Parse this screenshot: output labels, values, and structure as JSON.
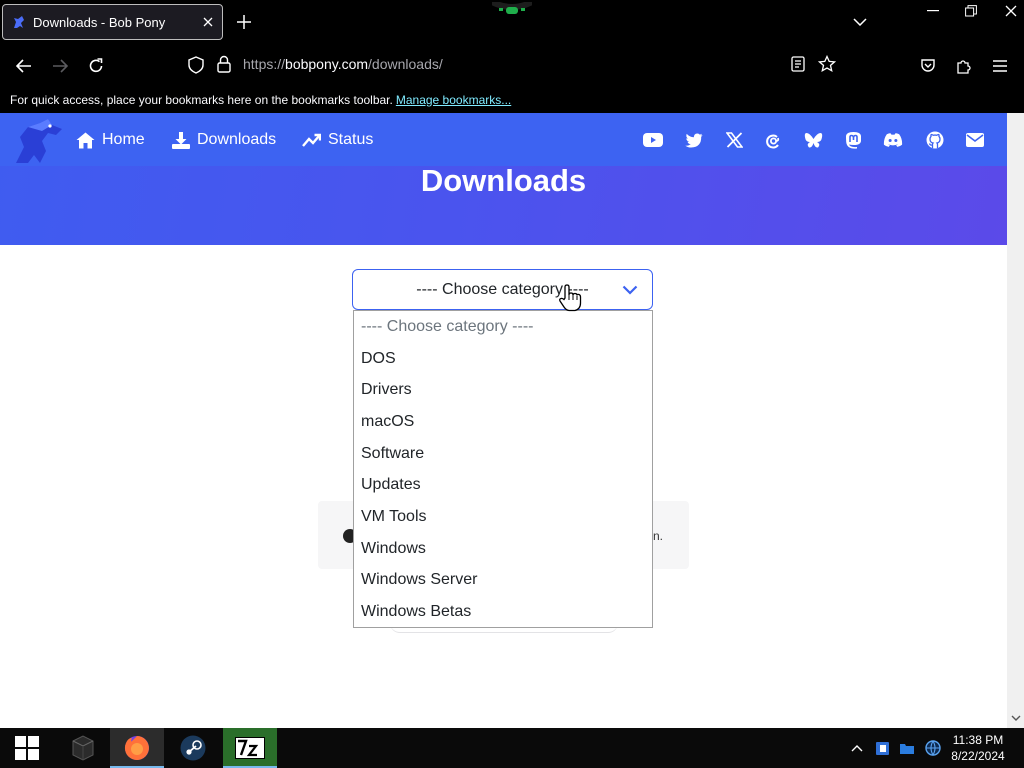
{
  "browser": {
    "tab_title": "Downloads - Bob Pony",
    "url_scheme": "https://",
    "url_host": "bobpony.com",
    "url_path": "/downloads/",
    "bookmarks_hint": "For quick access, place your bookmarks here on the bookmarks toolbar.",
    "bookmarks_link": "Manage bookmarks..."
  },
  "site": {
    "nav": [
      {
        "label": "Home",
        "icon": "home-icon"
      },
      {
        "label": "Downloads",
        "icon": "download-icon"
      },
      {
        "label": "Status",
        "icon": "trend-icon"
      }
    ],
    "social": [
      "youtube-icon",
      "twitter-icon",
      "x-icon",
      "threads-icon",
      "bluesky-icon",
      "mastodon-icon",
      "discord-icon",
      "github-icon",
      "mail-icon"
    ],
    "page_title": "Downloads",
    "select": {
      "value": "---- Choose category ----",
      "options": [
        "---- Choose category ----",
        "DOS",
        "Drivers",
        "macOS",
        "Software",
        "Updates",
        "VM Tools",
        "Windows",
        "Windows Server",
        "Windows Betas"
      ]
    },
    "info_tail": "n."
  },
  "taskbar": {
    "apps": [
      "start-icon",
      "terminal-icon",
      "firefox-icon",
      "steam-icon",
      "7zip-icon"
    ],
    "time": "11:38 PM",
    "date": "8/22/2024"
  },
  "colors": {
    "accent": "#3c62f1",
    "hero_start": "#3f5cf0",
    "hero_end": "#5b4ae9"
  }
}
